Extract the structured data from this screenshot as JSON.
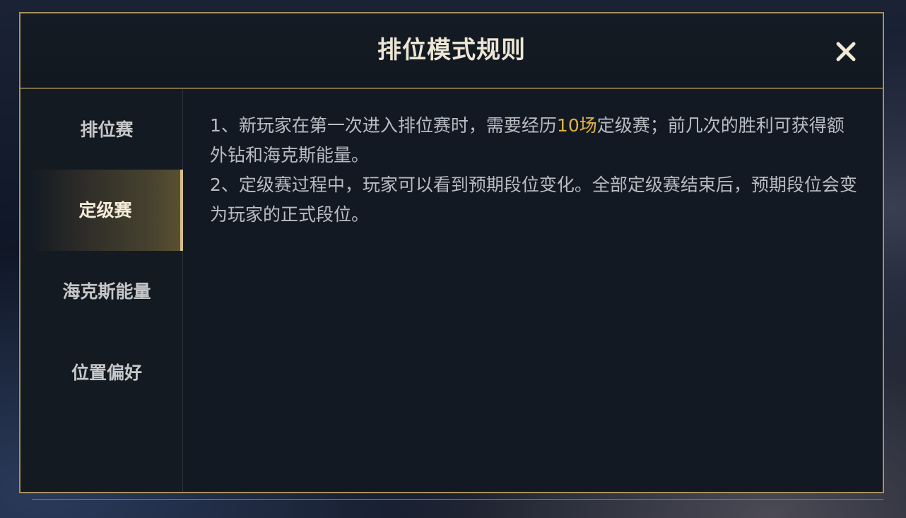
{
  "dialog": {
    "title": "排位模式规则",
    "close_icon": "close-icon"
  },
  "sidebar": {
    "items": [
      {
        "label": "排位赛",
        "active": false
      },
      {
        "label": "定级赛",
        "active": true
      },
      {
        "label": "海克斯能量",
        "active": false
      },
      {
        "label": "位置偏好",
        "active": false
      }
    ]
  },
  "content": {
    "paragraphs": [
      {
        "before": "1、新玩家在第一次进入排位赛时，需要经历",
        "highlight": "10场",
        "after": "定级赛；前几次的胜利可获得额外钻和海克斯能量。"
      },
      {
        "text": "2、定级赛过程中，玩家可以看到预期段位变化。全部定级赛结束后，预期段位会变为玩家的正式段位。"
      }
    ]
  },
  "colors": {
    "accent_gold": "#a8915e",
    "highlight": "#e0b43b",
    "panel_bg": "#121923",
    "text": "#b9bcc1",
    "title_text": "#ede6d4"
  }
}
